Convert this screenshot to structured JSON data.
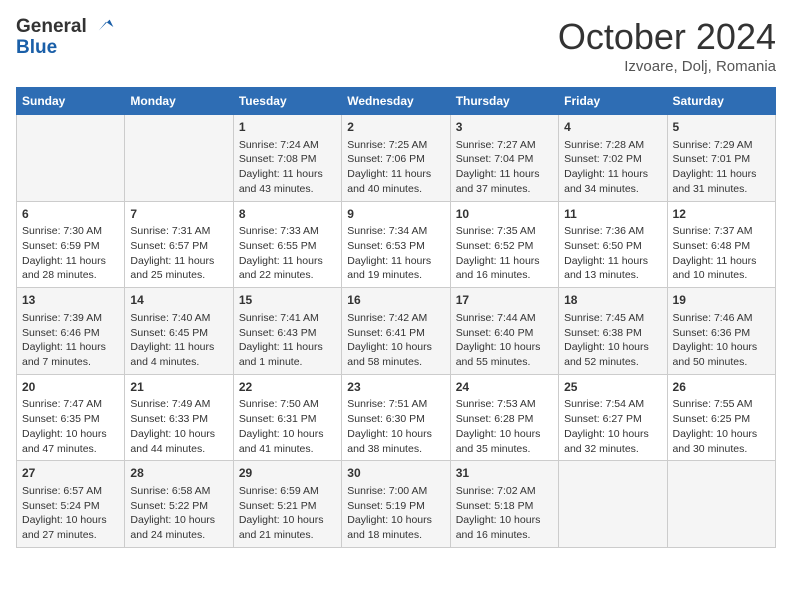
{
  "logo": {
    "line1": "General",
    "line2": "Blue"
  },
  "title": "October 2024",
  "subtitle": "Izvoare, Dolj, Romania",
  "days_header": [
    "Sunday",
    "Monday",
    "Tuesday",
    "Wednesday",
    "Thursday",
    "Friday",
    "Saturday"
  ],
  "weeks": [
    [
      {
        "day": "",
        "sunrise": "",
        "sunset": "",
        "daylight": ""
      },
      {
        "day": "",
        "sunrise": "",
        "sunset": "",
        "daylight": ""
      },
      {
        "day": "1",
        "sunrise": "Sunrise: 7:24 AM",
        "sunset": "Sunset: 7:08 PM",
        "daylight": "Daylight: 11 hours and 43 minutes."
      },
      {
        "day": "2",
        "sunrise": "Sunrise: 7:25 AM",
        "sunset": "Sunset: 7:06 PM",
        "daylight": "Daylight: 11 hours and 40 minutes."
      },
      {
        "day": "3",
        "sunrise": "Sunrise: 7:27 AM",
        "sunset": "Sunset: 7:04 PM",
        "daylight": "Daylight: 11 hours and 37 minutes."
      },
      {
        "day": "4",
        "sunrise": "Sunrise: 7:28 AM",
        "sunset": "Sunset: 7:02 PM",
        "daylight": "Daylight: 11 hours and 34 minutes."
      },
      {
        "day": "5",
        "sunrise": "Sunrise: 7:29 AM",
        "sunset": "Sunset: 7:01 PM",
        "daylight": "Daylight: 11 hours and 31 minutes."
      }
    ],
    [
      {
        "day": "6",
        "sunrise": "Sunrise: 7:30 AM",
        "sunset": "Sunset: 6:59 PM",
        "daylight": "Daylight: 11 hours and 28 minutes."
      },
      {
        "day": "7",
        "sunrise": "Sunrise: 7:31 AM",
        "sunset": "Sunset: 6:57 PM",
        "daylight": "Daylight: 11 hours and 25 minutes."
      },
      {
        "day": "8",
        "sunrise": "Sunrise: 7:33 AM",
        "sunset": "Sunset: 6:55 PM",
        "daylight": "Daylight: 11 hours and 22 minutes."
      },
      {
        "day": "9",
        "sunrise": "Sunrise: 7:34 AM",
        "sunset": "Sunset: 6:53 PM",
        "daylight": "Daylight: 11 hours and 19 minutes."
      },
      {
        "day": "10",
        "sunrise": "Sunrise: 7:35 AM",
        "sunset": "Sunset: 6:52 PM",
        "daylight": "Daylight: 11 hours and 16 minutes."
      },
      {
        "day": "11",
        "sunrise": "Sunrise: 7:36 AM",
        "sunset": "Sunset: 6:50 PM",
        "daylight": "Daylight: 11 hours and 13 minutes."
      },
      {
        "day": "12",
        "sunrise": "Sunrise: 7:37 AM",
        "sunset": "Sunset: 6:48 PM",
        "daylight": "Daylight: 11 hours and 10 minutes."
      }
    ],
    [
      {
        "day": "13",
        "sunrise": "Sunrise: 7:39 AM",
        "sunset": "Sunset: 6:46 PM",
        "daylight": "Daylight: 11 hours and 7 minutes."
      },
      {
        "day": "14",
        "sunrise": "Sunrise: 7:40 AM",
        "sunset": "Sunset: 6:45 PM",
        "daylight": "Daylight: 11 hours and 4 minutes."
      },
      {
        "day": "15",
        "sunrise": "Sunrise: 7:41 AM",
        "sunset": "Sunset: 6:43 PM",
        "daylight": "Daylight: 11 hours and 1 minute."
      },
      {
        "day": "16",
        "sunrise": "Sunrise: 7:42 AM",
        "sunset": "Sunset: 6:41 PM",
        "daylight": "Daylight: 10 hours and 58 minutes."
      },
      {
        "day": "17",
        "sunrise": "Sunrise: 7:44 AM",
        "sunset": "Sunset: 6:40 PM",
        "daylight": "Daylight: 10 hours and 55 minutes."
      },
      {
        "day": "18",
        "sunrise": "Sunrise: 7:45 AM",
        "sunset": "Sunset: 6:38 PM",
        "daylight": "Daylight: 10 hours and 52 minutes."
      },
      {
        "day": "19",
        "sunrise": "Sunrise: 7:46 AM",
        "sunset": "Sunset: 6:36 PM",
        "daylight": "Daylight: 10 hours and 50 minutes."
      }
    ],
    [
      {
        "day": "20",
        "sunrise": "Sunrise: 7:47 AM",
        "sunset": "Sunset: 6:35 PM",
        "daylight": "Daylight: 10 hours and 47 minutes."
      },
      {
        "day": "21",
        "sunrise": "Sunrise: 7:49 AM",
        "sunset": "Sunset: 6:33 PM",
        "daylight": "Daylight: 10 hours and 44 minutes."
      },
      {
        "day": "22",
        "sunrise": "Sunrise: 7:50 AM",
        "sunset": "Sunset: 6:31 PM",
        "daylight": "Daylight: 10 hours and 41 minutes."
      },
      {
        "day": "23",
        "sunrise": "Sunrise: 7:51 AM",
        "sunset": "Sunset: 6:30 PM",
        "daylight": "Daylight: 10 hours and 38 minutes."
      },
      {
        "day": "24",
        "sunrise": "Sunrise: 7:53 AM",
        "sunset": "Sunset: 6:28 PM",
        "daylight": "Daylight: 10 hours and 35 minutes."
      },
      {
        "day": "25",
        "sunrise": "Sunrise: 7:54 AM",
        "sunset": "Sunset: 6:27 PM",
        "daylight": "Daylight: 10 hours and 32 minutes."
      },
      {
        "day": "26",
        "sunrise": "Sunrise: 7:55 AM",
        "sunset": "Sunset: 6:25 PM",
        "daylight": "Daylight: 10 hours and 30 minutes."
      }
    ],
    [
      {
        "day": "27",
        "sunrise": "Sunrise: 6:57 AM",
        "sunset": "Sunset: 5:24 PM",
        "daylight": "Daylight: 10 hours and 27 minutes."
      },
      {
        "day": "28",
        "sunrise": "Sunrise: 6:58 AM",
        "sunset": "Sunset: 5:22 PM",
        "daylight": "Daylight: 10 hours and 24 minutes."
      },
      {
        "day": "29",
        "sunrise": "Sunrise: 6:59 AM",
        "sunset": "Sunset: 5:21 PM",
        "daylight": "Daylight: 10 hours and 21 minutes."
      },
      {
        "day": "30",
        "sunrise": "Sunrise: 7:00 AM",
        "sunset": "Sunset: 5:19 PM",
        "daylight": "Daylight: 10 hours and 18 minutes."
      },
      {
        "day": "31",
        "sunrise": "Sunrise: 7:02 AM",
        "sunset": "Sunset: 5:18 PM",
        "daylight": "Daylight: 10 hours and 16 minutes."
      },
      {
        "day": "",
        "sunrise": "",
        "sunset": "",
        "daylight": ""
      },
      {
        "day": "",
        "sunrise": "",
        "sunset": "",
        "daylight": ""
      }
    ]
  ]
}
